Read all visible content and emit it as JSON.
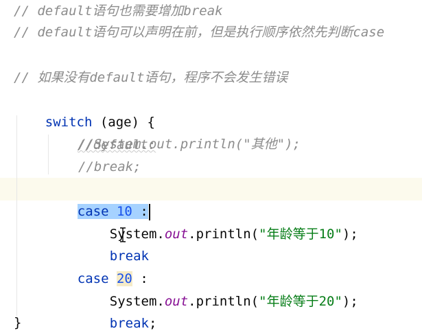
{
  "editor": {
    "lines": [
      {
        "name": "comment-line-1",
        "text": "// default语句也需要增加break"
      },
      {
        "name": "comment-line-2",
        "text": "// default语句可以声明在前，但是执行顺序依然先判断case"
      },
      {
        "name": "comment-line-3",
        "text": "// 如果没有default语句，程序不会发生错误"
      }
    ],
    "switch_keyword": "switch",
    "switch_condition": " (age) {",
    "default_comment": "//default:",
    "sysout_comment": "//System.out.println(\"其他\");",
    "break_comment": "//break;",
    "case1": {
      "keyword": "case",
      "value": "10",
      "colon": " :",
      "print_prefix": "System.",
      "print_field": "out",
      "print_method": ".println(",
      "print_string": "\"年龄等于10\"",
      "print_suffix": ");",
      "break_text": "break",
      "break_semicolon": ";"
    },
    "case2": {
      "keyword": "case",
      "value": "20",
      "colon": " :",
      "print_prefix": "System.",
      "print_field": "out",
      "print_method": ".println(",
      "print_string": "\"年龄等于20\"",
      "print_suffix": ");",
      "break_text": "break",
      "break_semicolon": ";"
    },
    "closing_brace": "}"
  },
  "colors": {
    "comment": "#8c8c8c",
    "keyword": "#0033b3",
    "number": "#1750eb",
    "string": "#067d17",
    "field": "#871094",
    "selection": "#a6d2ff",
    "caret_row": "#fcfaed"
  },
  "cursor": {
    "icon": "text-ibeam-icon"
  }
}
